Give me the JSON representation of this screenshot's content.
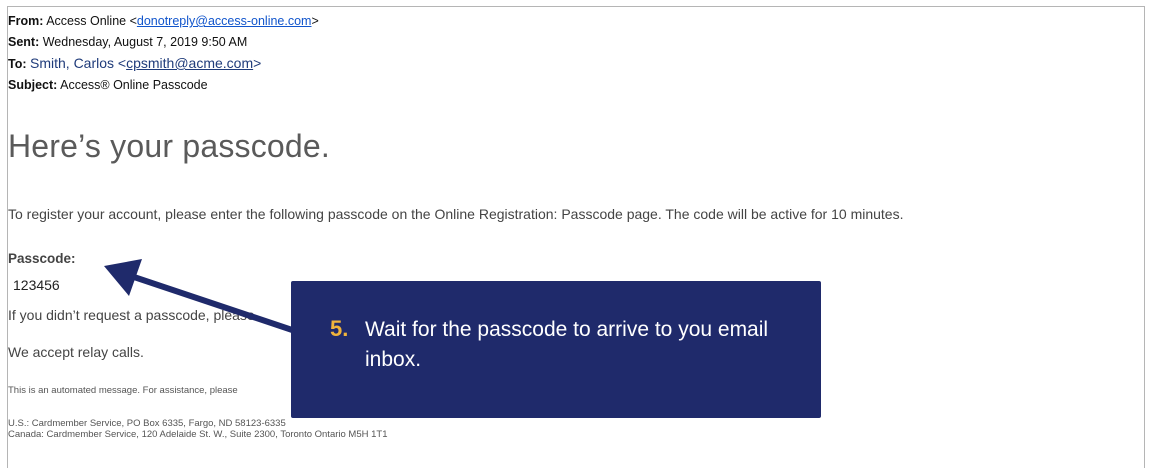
{
  "header": {
    "from_label": "From:",
    "from_name": "Access Online <",
    "from_email": "donotreply@access-online.com",
    "from_close": ">",
    "sent_label": "Sent:",
    "sent_value": "Wednesday, August 7, 2019 9:50 AM",
    "to_label": "To:",
    "to_name": "Smith, Carlos <",
    "to_email": "cpsmith@acme.com",
    "to_close": ">",
    "subject_label": "Subject:",
    "subject_value": "Access® Online Passcode"
  },
  "body": {
    "headline": "Here’s your passcode.",
    "intro": "To register your account, please enter the following passcode on the Online Registration: Passcode page. The code will be active for 10 minutes.",
    "passcode_label": "Passcode:",
    "passcode_value": "123456",
    "didnt_request": "If you didn’t request a passcode, please",
    "relay": "We accept relay calls.",
    "automated": "This is an automated message. For assistance, please",
    "address_us": "U.S.: Cardmember Service, PO Box 6335, Fargo, ND 58123-6335",
    "address_ca": "Canada: Cardmember Service, 120 Adelaide St. W., Suite 2300, Toronto Ontario M5H 1T1"
  },
  "callout": {
    "step_number": "5.",
    "text": "Wait for the passcode to arrive to you email inbox."
  },
  "colors": {
    "callout_bg": "#1f2a6b",
    "step_number": "#f0b43c",
    "arrow": "#1f2a6b",
    "link": "#1155cc"
  }
}
